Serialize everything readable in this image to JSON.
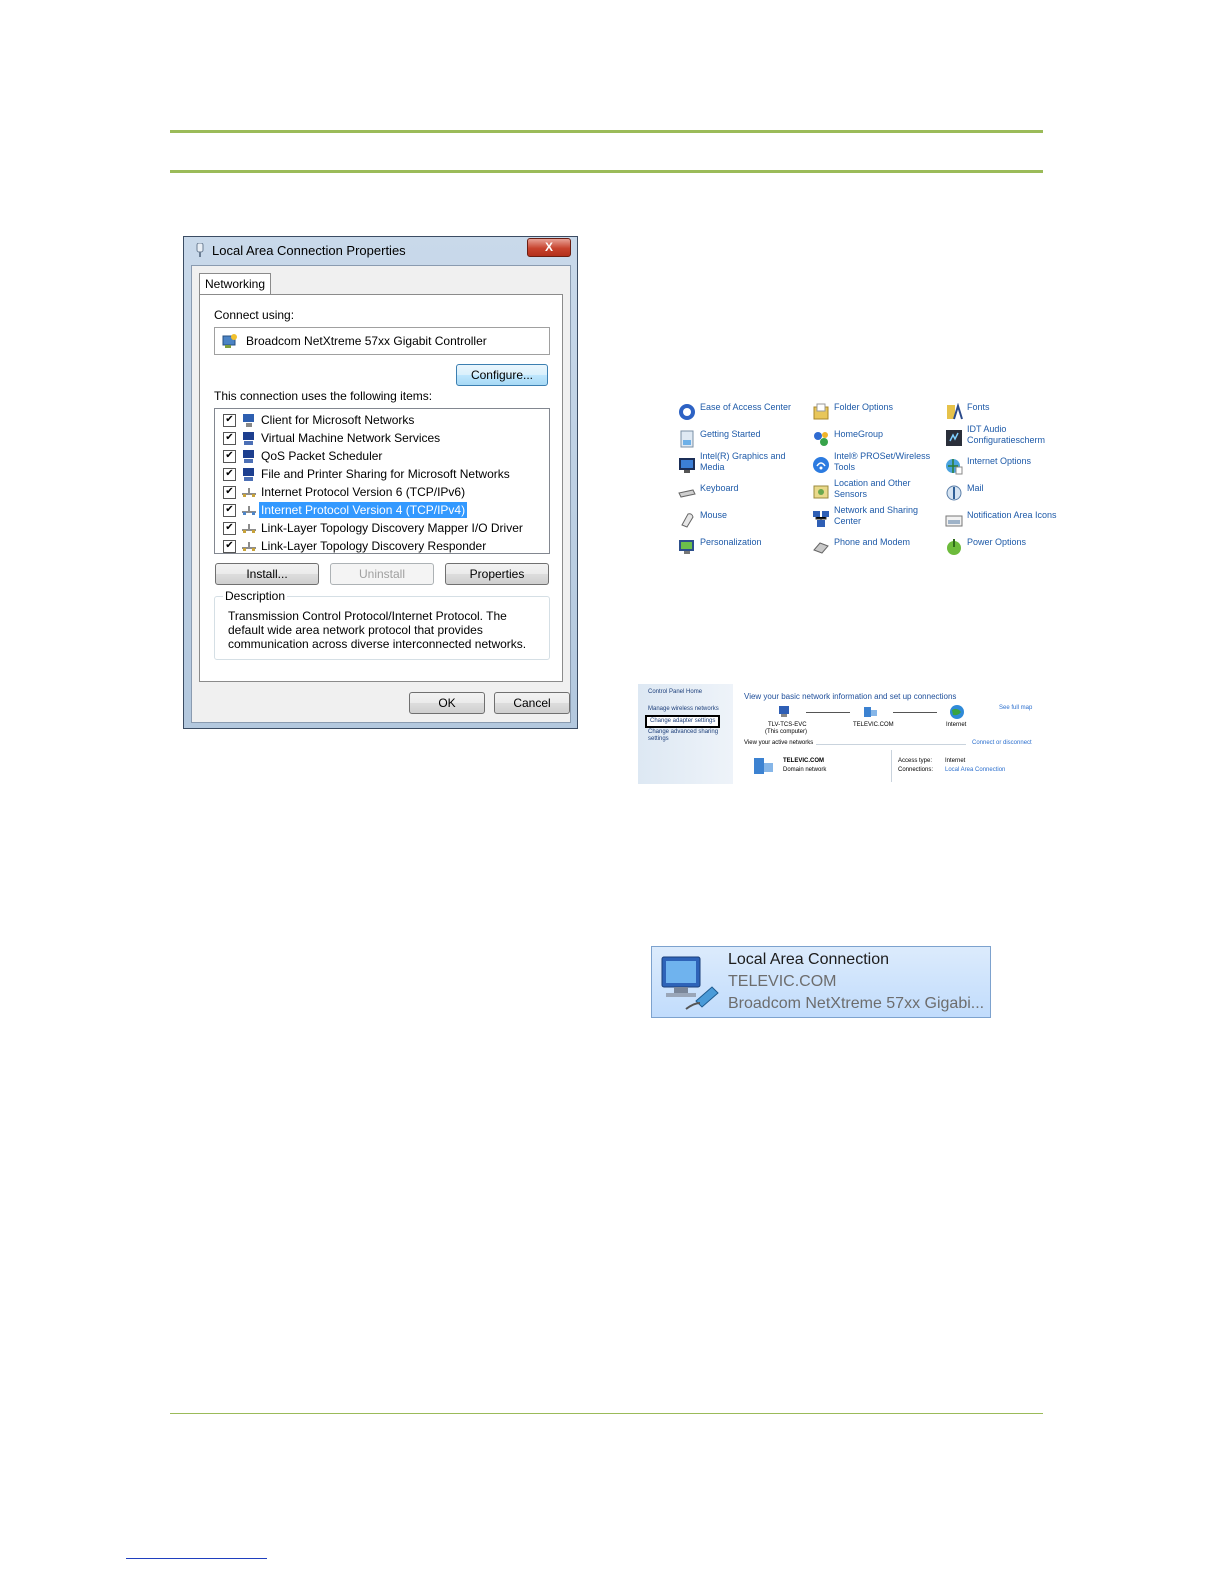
{
  "dialog": {
    "title": "Local Area Connection Properties",
    "close_label": "X",
    "tab": "Networking",
    "connect_using_label": "Connect using:",
    "adapter": "Broadcom NetXtreme 57xx Gigabit Controller",
    "configure_label": "Configure...",
    "items_label": "This connection uses the following items:",
    "items": [
      {
        "label": "Client for Microsoft Networks",
        "checked": true,
        "icon": "network-client-icon"
      },
      {
        "label": "Virtual Machine Network Services",
        "checked": true,
        "icon": "network-service-icon"
      },
      {
        "label": "QoS Packet Scheduler",
        "checked": true,
        "icon": "network-service-icon"
      },
      {
        "label": "File and Printer Sharing for Microsoft Networks",
        "checked": true,
        "icon": "network-service-icon"
      },
      {
        "label": "Internet Protocol Version 6 (TCP/IPv6)",
        "checked": true,
        "icon": "protocol-icon"
      },
      {
        "label": "Internet Protocol Version 4 (TCP/IPv4)",
        "checked": true,
        "icon": "protocol-icon",
        "selected": true
      },
      {
        "label": "Link-Layer Topology Discovery Mapper I/O Driver",
        "checked": true,
        "icon": "protocol-icon"
      },
      {
        "label": "Link-Layer Topology Discovery Responder",
        "checked": true,
        "icon": "protocol-icon"
      }
    ],
    "install_label": "Install...",
    "uninstall_label": "Uninstall",
    "properties_label": "Properties",
    "description_label": "Description",
    "description": "Transmission Control Protocol/Internet Protocol. The default wide area network protocol that provides communication across diverse interconnected networks.",
    "ok_label": "OK",
    "cancel_label": "Cancel"
  },
  "control_panel": {
    "items": [
      {
        "label": "Ease of Access Center",
        "icon": "ease-of-access-icon"
      },
      {
        "label": "Folder Options",
        "icon": "folder-icon"
      },
      {
        "label": "Fonts",
        "icon": "fonts-icon"
      },
      {
        "label": "Getting Started",
        "icon": "getting-started-icon"
      },
      {
        "label": "HomeGroup",
        "icon": "homegroup-icon"
      },
      {
        "label": "IDT Audio Configuratiescherm",
        "icon": "audio-icon"
      },
      {
        "label": "Intel(R) Graphics and Media",
        "icon": "graphics-icon"
      },
      {
        "label": "Intel® PROSet/Wireless Tools",
        "icon": "wireless-icon"
      },
      {
        "label": "Internet Options",
        "icon": "internet-options-icon"
      },
      {
        "label": "Keyboard",
        "icon": "keyboard-icon"
      },
      {
        "label": "Location and Other Sensors",
        "icon": "sensors-icon"
      },
      {
        "label": "Mail",
        "icon": "mail-icon"
      },
      {
        "label": "Mouse",
        "icon": "mouse-icon"
      },
      {
        "label": "Network and Sharing Center",
        "icon": "network-sharing-icon"
      },
      {
        "label": "Notification Area Icons",
        "icon": "notification-icon"
      },
      {
        "label": "Personalization",
        "icon": "personalization-icon"
      },
      {
        "label": "Phone and Modem",
        "icon": "phone-modem-icon"
      },
      {
        "label": "Power Options",
        "icon": "power-icon"
      }
    ]
  },
  "network_center": {
    "sidebar": {
      "home": "Control Panel Home",
      "manage_wireless": "Manage wireless networks",
      "change_adapter": "Change adapter settings",
      "change_sharing": "Change advanced sharing settings"
    },
    "heading": "View your basic network information and set up connections",
    "see_full_map": "See full map",
    "computer": "TLV-TCS-EVC",
    "computer_note": "(This computer)",
    "network": "TELEVIC.COM",
    "internet": "Internet",
    "active_networks": "View your active networks",
    "connect_disconnect": "Connect or disconnect",
    "active_name": "TELEVIC.COM",
    "active_type": "Domain network",
    "access_type_label": "Access type:",
    "access_type": "Internet",
    "connections_label": "Connections:",
    "connection": "Local Area Connection"
  },
  "tile": {
    "name": "Local Area Connection",
    "network": "TELEVIC.COM",
    "device": "Broadcom NetXtreme 57xx Gigabi..."
  }
}
